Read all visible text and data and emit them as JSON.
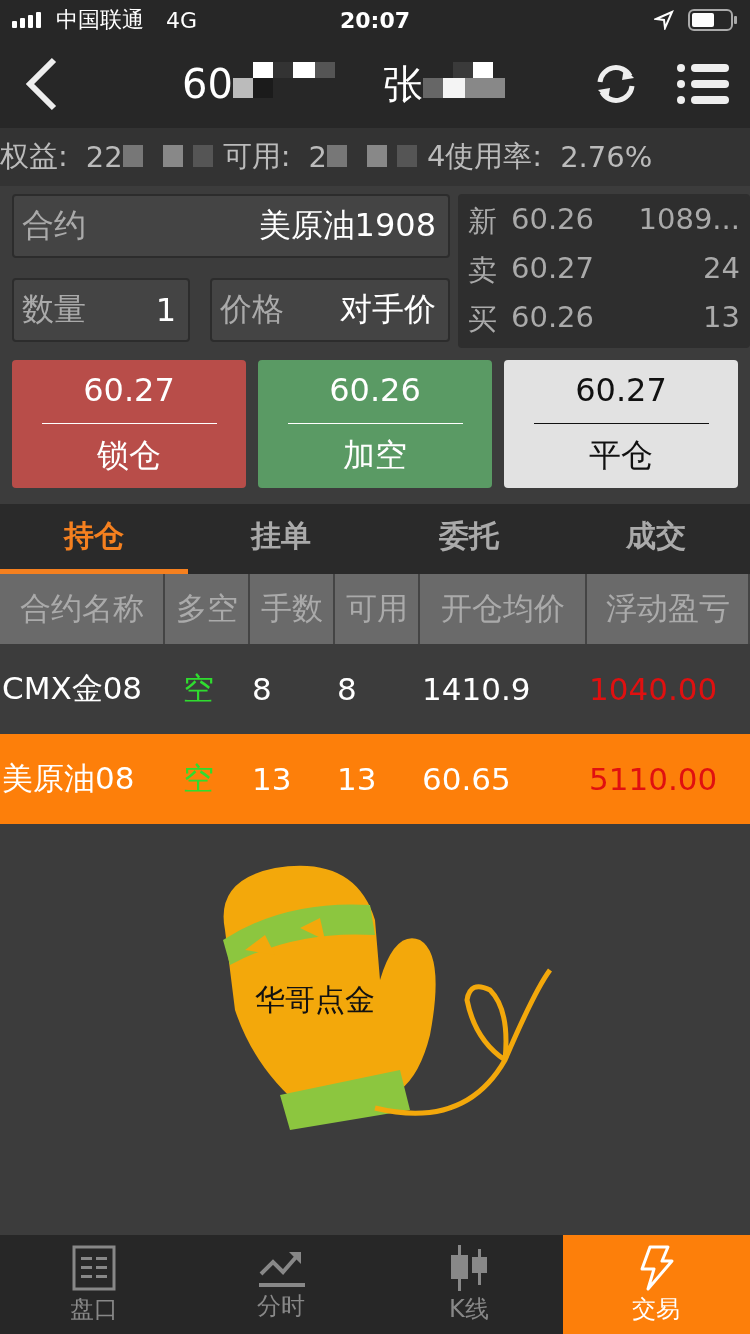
{
  "status_bar": {
    "carrier": "中国联通",
    "network": "4G",
    "time": "20:07"
  },
  "nav": {
    "title_visible": "60",
    "title_name": "张"
  },
  "account": [
    {
      "label": "权益:",
      "value": "22"
    },
    {
      "label": "可用:",
      "value": "2"
    },
    {
      "label": "4使用率:",
      "value": "2.76%"
    }
  ],
  "order_form": {
    "contract": {
      "label": "合约",
      "value": "美原油1908"
    },
    "quantity": {
      "label": "数量",
      "value": "1"
    },
    "price": {
      "label": "价格",
      "value": "对手价"
    }
  },
  "quotes": [
    {
      "label": "新",
      "price": "60.26",
      "volume": "1089..."
    },
    {
      "label": "卖",
      "price": "60.27",
      "volume": "24"
    },
    {
      "label": "买",
      "price": "60.26",
      "volume": "13"
    }
  ],
  "actions": [
    {
      "kind": "lock",
      "price": "60.27",
      "label": "锁仓"
    },
    {
      "kind": "short",
      "price": "60.26",
      "label": "加空"
    },
    {
      "kind": "close",
      "price": "60.27",
      "label": "平仓"
    }
  ],
  "tabs": [
    {
      "label": "持仓",
      "selected": true
    },
    {
      "label": "挂单",
      "selected": false
    },
    {
      "label": "委托",
      "selected": false
    },
    {
      "label": "成交",
      "selected": false
    }
  ],
  "table": {
    "columns": [
      "合约名称",
      "多空",
      "手数",
      "可用",
      "开仓均价",
      "浮动盈亏"
    ],
    "rows": [
      {
        "selected": false,
        "cells": [
          "CMX金08",
          "空",
          "8",
          "8",
          "1410.9",
          "1040.00"
        ]
      },
      {
        "selected": true,
        "cells": [
          "美原油08",
          "空",
          "13",
          "13",
          "60.65",
          "5110.00"
        ]
      }
    ]
  },
  "logo_text": "华哥点金",
  "bottom_nav": [
    {
      "kind": "book",
      "label": "盘口",
      "selected": false
    },
    {
      "kind": "trend",
      "label": "分时",
      "selected": false
    },
    {
      "kind": "candle",
      "label": "K线",
      "selected": false
    },
    {
      "kind": "bolt",
      "label": "交易",
      "selected": true
    }
  ]
}
